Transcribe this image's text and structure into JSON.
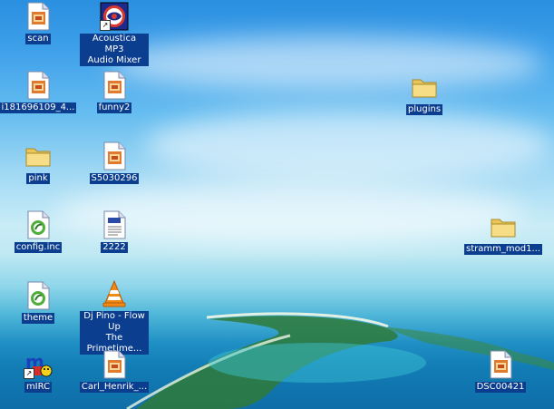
{
  "desktop": {
    "icons": [
      {
        "label": "scan",
        "type": "image"
      },
      {
        "label": "Acoustica MP3\nAudio Mixer",
        "type": "app-shortcut"
      },
      {
        "label": "i181696109_4...",
        "type": "image"
      },
      {
        "label": "funny2",
        "type": "image"
      },
      {
        "label": "plugins",
        "type": "folder"
      },
      {
        "label": "pink",
        "type": "folder"
      },
      {
        "label": "S5030296",
        "type": "image"
      },
      {
        "label": "config.inc",
        "type": "script"
      },
      {
        "label": "2222",
        "type": "text-file"
      },
      {
        "label": "stramm_mod1...",
        "type": "folder"
      },
      {
        "label": "theme",
        "type": "script"
      },
      {
        "label": "Dj Pino - Flow Up\nThe Primetime...",
        "type": "vlc-media"
      },
      {
        "label": "mIRC",
        "type": "app-shortcut"
      },
      {
        "label": "Carl_Henrik_...",
        "type": "image"
      },
      {
        "label": "DSC00421",
        "type": "image"
      }
    ]
  }
}
